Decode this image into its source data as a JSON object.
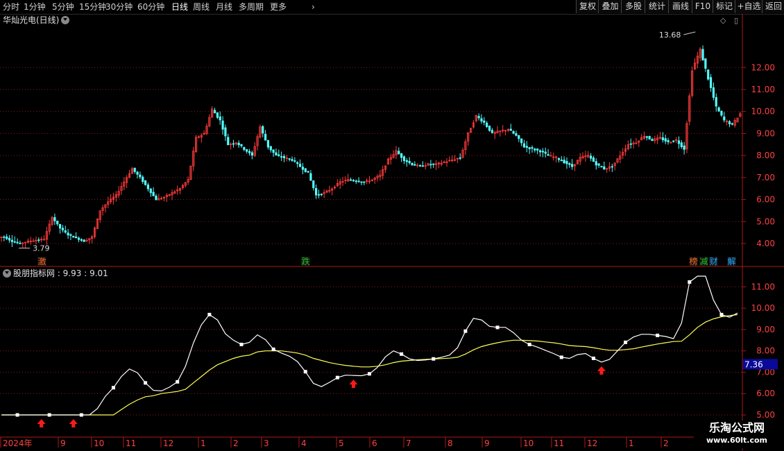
{
  "toolbar": {
    "periods": [
      "分时",
      "1分钟",
      "5分钟",
      "15分钟",
      "30分钟",
      "60分钟",
      "日线",
      "周线",
      "月线",
      "多周期",
      "更多"
    ],
    "active_period": "日线",
    "buttons": [
      "复权",
      "叠加",
      "多股",
      "统计",
      "画线",
      "F10",
      "标记",
      "+自选",
      "返回"
    ]
  },
  "price_panel": {
    "title": "华灿光电(日线)",
    "max_label": "13.68",
    "min_label": "3.79",
    "y_ticks": [
      4.0,
      5.0,
      6.0,
      7.0,
      8.0,
      9.0,
      10.0,
      11.0,
      12.0
    ],
    "event_tags": [
      {
        "text": "激",
        "color": "#ff6a1f"
      },
      {
        "text": "跌",
        "color": "#22c422"
      },
      {
        "text": "榜",
        "color": "#ff6a1f"
      },
      {
        "text": "减",
        "color": "#22c422"
      },
      {
        "text": "财",
        "color": "#22aaff"
      },
      {
        "text": "解",
        "color": "#22aaff"
      }
    ]
  },
  "indicator_panel": {
    "title": "股朋指标网 : 9.93 : 9.01",
    "y_ticks": [
      5.0,
      6.0,
      7.0,
      8.0,
      9.0,
      10.0,
      11.0
    ],
    "cursor_value": "7.36"
  },
  "x_axis": {
    "labels": [
      "2024年",
      "9",
      "10",
      "11",
      "12",
      "1",
      "2",
      "3",
      "4",
      "5",
      "6",
      "7",
      "8",
      "9",
      "10",
      "11",
      "12",
      "1",
      "2"
    ]
  },
  "watermark": {
    "line1": "乐淘公式网",
    "line2": "www.60lt.com"
  },
  "colors": {
    "up": "#ff3b3b",
    "down": "#54ffff",
    "fast_line": "#ffffff",
    "slow_line": "#ffff55",
    "grid": "#8a1a1a",
    "axis_text": "#ff4040"
  },
  "chart_data": {
    "type": "line",
    "series": [
      {
        "name": "",
        "values": [
          4.3,
          4.1,
          4.0,
          4.1,
          4.15,
          4.2,
          5.2,
          4.7,
          4.4,
          4.25,
          4.1,
          4.3,
          5.5,
          5.9,
          6.2,
          6.8,
          7.4,
          7.0,
          6.5,
          6.0,
          6.1,
          6.3,
          6.5,
          6.9,
          8.8,
          9.0,
          10.1,
          9.6,
          8.5,
          8.6,
          8.3,
          8.0,
          9.3,
          8.4,
          8.0,
          7.9,
          7.8,
          7.5,
          7.2,
          6.2,
          6.3,
          6.5,
          6.8,
          6.9,
          6.85,
          6.8,
          6.9,
          7.1,
          7.8,
          8.2,
          7.8,
          7.6,
          7.5,
          7.6,
          7.6,
          7.7,
          7.8,
          7.9,
          9.0,
          9.8,
          9.5,
          9.0,
          9.1,
          9.2,
          8.9,
          8.4,
          8.3,
          8.2,
          8.0,
          7.9,
          7.7,
          7.5,
          7.9,
          8.0,
          7.6,
          7.4,
          7.5,
          8.0,
          8.5,
          8.6,
          8.9,
          8.7,
          8.8,
          8.6,
          8.7,
          8.3,
          11.9,
          12.8,
          11.5,
          10.2,
          9.6,
          9.4,
          9.9
        ]
      },
      {
        "name": "",
        "values": [
          4.3,
          4.25,
          4.15,
          4.15,
          4.14,
          4.16,
          4.3,
          4.4,
          4.45,
          4.45,
          4.4,
          4.4,
          4.6,
          4.8,
          5.0,
          5.25,
          5.5,
          5.7,
          5.85,
          5.9,
          6.0,
          6.05,
          6.1,
          6.2,
          6.5,
          6.8,
          7.1,
          7.35,
          7.5,
          7.65,
          7.75,
          7.8,
          7.95,
          8.0,
          8.0,
          8.0,
          7.95,
          7.9,
          7.8,
          7.65,
          7.55,
          7.45,
          7.38,
          7.32,
          7.28,
          7.25,
          7.25,
          7.28,
          7.35,
          7.45,
          7.52,
          7.55,
          7.58,
          7.6,
          7.62,
          7.64,
          7.66,
          7.7,
          7.85,
          8.05,
          8.2,
          8.3,
          8.38,
          8.45,
          8.5,
          8.5,
          8.48,
          8.46,
          8.42,
          8.38,
          8.32,
          8.25,
          8.22,
          8.2,
          8.15,
          8.08,
          8.03,
          8.03,
          8.06,
          8.1,
          8.18,
          8.25,
          8.32,
          8.38,
          8.44,
          8.45,
          8.75,
          9.1,
          9.35,
          9.5,
          9.6,
          9.65,
          9.7
        ]
      }
    ],
    "ylabel": "",
    "ylim": [
      3.4,
      13.9
    ]
  }
}
